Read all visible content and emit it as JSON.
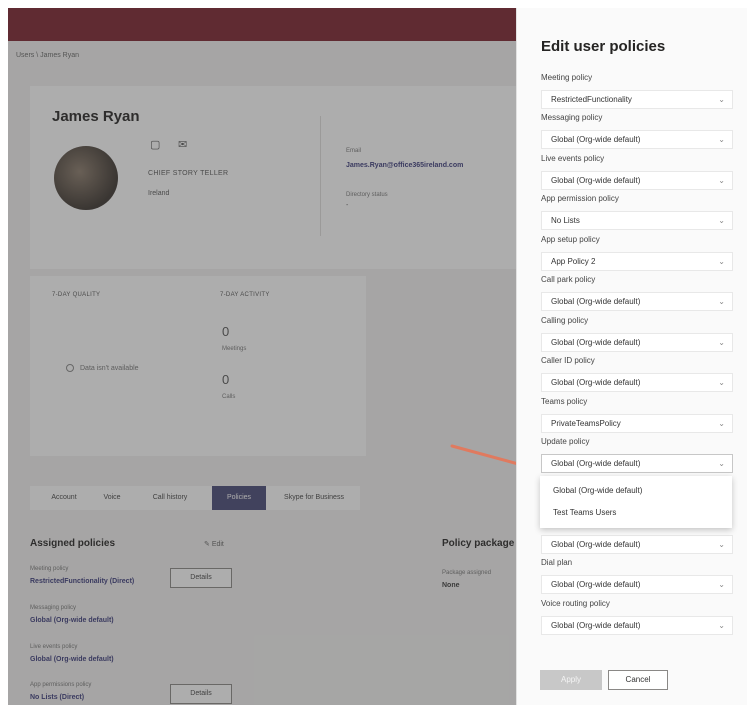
{
  "app": {
    "breadcrumb": "Users \\ James Ryan"
  },
  "profile": {
    "name": "James Ryan",
    "icon_chat": "chat-icon",
    "icon_mail": "mail-icon",
    "job_title": "CHIEF STORY TELLER",
    "location": "Ireland",
    "email_label": "Email",
    "email": "James.Ryan@office365ireland.com",
    "directory_label": "Directory status",
    "directory_value": "-"
  },
  "call_quality": {
    "title": "7-DAY QUALITY",
    "empty": "Data isn't available"
  },
  "activity": {
    "title": "7-DAY ACTIVITY",
    "meetings_value": "0",
    "meetings_label": "Meetings",
    "calls_value": "0",
    "calls_label": "Calls"
  },
  "tabs": [
    "Account",
    "Voice",
    "Call history",
    "Policies",
    "Skype for Business"
  ],
  "assigned": {
    "title": "Assigned policies",
    "edit_label": "Edit",
    "rows": [
      {
        "label": "Meeting policy",
        "value": "RestrictedFunctionality (Direct)",
        "button": "Details"
      },
      {
        "label": "Messaging policy",
        "value": "Global (Org-wide default)",
        "button": ""
      },
      {
        "label": "Live events policy",
        "value": "Global (Org-wide default)",
        "button": ""
      },
      {
        "label": "App permissions policy",
        "value": "No Lists (Direct)",
        "button": "Details"
      }
    ]
  },
  "package": {
    "title": "Policy package",
    "label": "Package assigned",
    "value": "None"
  },
  "panel": {
    "title": "Edit user policies",
    "fields": [
      {
        "label": "Meeting policy",
        "value": "RestrictedFunctionality"
      },
      {
        "label": "Messaging policy",
        "value": "Global (Org-wide default)"
      },
      {
        "label": "Live events policy",
        "value": "Global (Org-wide default)"
      },
      {
        "label": "App permission policy",
        "value": "No Lists"
      },
      {
        "label": "App setup policy",
        "value": "App Policy 2"
      },
      {
        "label": "Call park policy",
        "value": "Global (Org-wide default)"
      },
      {
        "label": "Calling policy",
        "value": "Global (Org-wide default)"
      },
      {
        "label": "Caller ID policy",
        "value": "Global (Org-wide default)"
      },
      {
        "label": "Teams policy",
        "value": "PrivateTeamsPolicy"
      },
      {
        "label": "Update policy",
        "value": "Global (Org-wide default)"
      },
      {
        "label": "",
        "value": "Global (Org-wide default)"
      },
      {
        "label": "Dial plan",
        "value": "Global (Org-wide default)"
      },
      {
        "label": "Voice routing policy",
        "value": "Global (Org-wide default)"
      }
    ],
    "menu_options": [
      "Global (Org-wide default)",
      "Test Teams Users"
    ],
    "apply_label": "Apply",
    "cancel_label": "Cancel"
  },
  "colors": {
    "topbar": "#7a1f2b",
    "active_tab": "#464775",
    "annotation_arrow": "#e07a5f"
  }
}
